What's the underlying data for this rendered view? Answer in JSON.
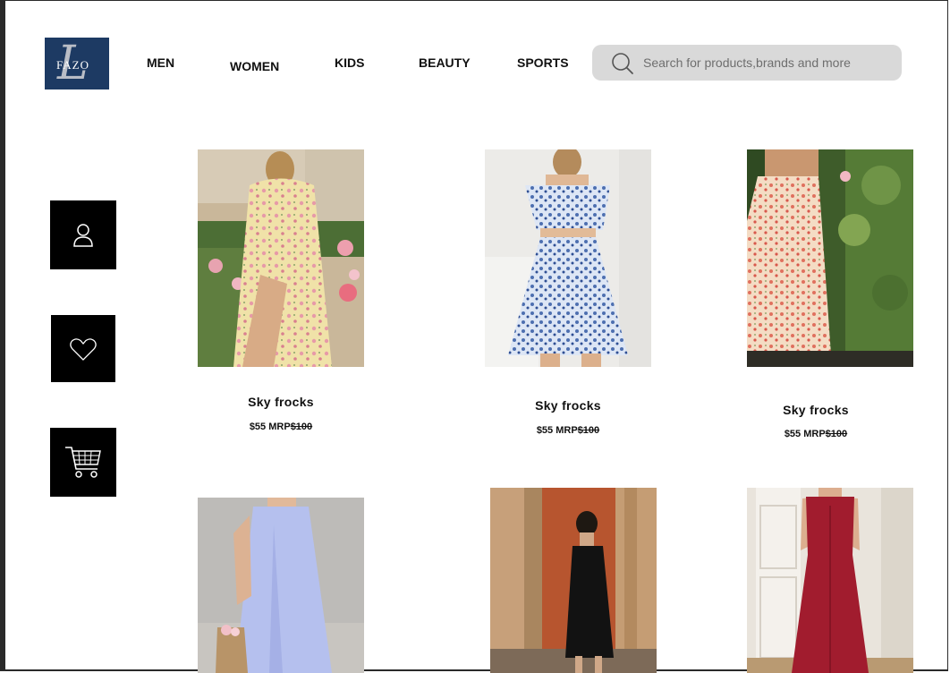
{
  "brand": {
    "logo_text": "FAZO",
    "logo_mark": "L"
  },
  "nav": [
    {
      "label": "MEN"
    },
    {
      "label": "WOMEN"
    },
    {
      "label": "KIDS"
    },
    {
      "label": "BEAUTY"
    },
    {
      "label": "SPORTS"
    }
  ],
  "search": {
    "placeholder": "Search for products,brands and more",
    "value": ""
  },
  "sidebar": [
    {
      "icon": "user-icon"
    },
    {
      "icon": "heart-icon"
    },
    {
      "icon": "cart-icon"
    }
  ],
  "products": [
    {
      "name": "Sky frocks",
      "price": "$55",
      "mrp_label": "MRP",
      "mrp": "$100",
      "image": "yellow-floral-dress"
    },
    {
      "name": "Sky frocks",
      "price": "$55",
      "mrp_label": "MRP",
      "mrp": "$100",
      "image": "blue-floral-two-piece"
    },
    {
      "name": "Sky frocks",
      "price": "$55",
      "mrp_label": "MRP",
      "mrp": "$100",
      "image": "peach-floral-slip-dress"
    },
    {
      "image": "lavender-maxi-dress"
    },
    {
      "image": "black-slip-dress"
    },
    {
      "image": "red-corset-dress"
    }
  ],
  "colors": {
    "search_bg": "#d9d9d9",
    "logo_bg": "#1d3a63",
    "sidebar_bg": "#000000"
  }
}
